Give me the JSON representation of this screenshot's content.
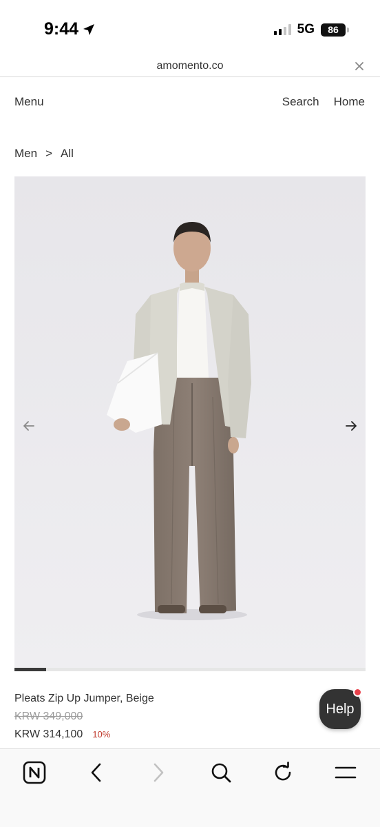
{
  "status_bar": {
    "time": "9:44",
    "network": "5G",
    "battery": "86"
  },
  "browser": {
    "url": "amomento.co",
    "close_icon": "close-icon"
  },
  "header": {
    "menu_label": "Menu",
    "search_label": "Search",
    "home_label": "Home"
  },
  "breadcrumb": {
    "items": [
      "Men",
      "All"
    ],
    "separator": ">"
  },
  "gallery": {
    "prev_icon": "arrow-left-icon",
    "next_icon": "arrow-right-icon",
    "progress": 0.09
  },
  "product": {
    "title": "Pleats Zip Up Jumper, Beige",
    "original_price": "KRW 349,000",
    "sale_price": "KRW 314,100",
    "discount": "10%"
  },
  "help": {
    "label": "Help"
  },
  "toolbar": {
    "icons": [
      "naver-home-icon",
      "back-icon",
      "forward-icon",
      "search-icon",
      "reload-icon",
      "menu-icon"
    ]
  },
  "colors": {
    "discount": "#c0392b",
    "help_bg": "#333333",
    "help_dot": "#e8414b"
  }
}
